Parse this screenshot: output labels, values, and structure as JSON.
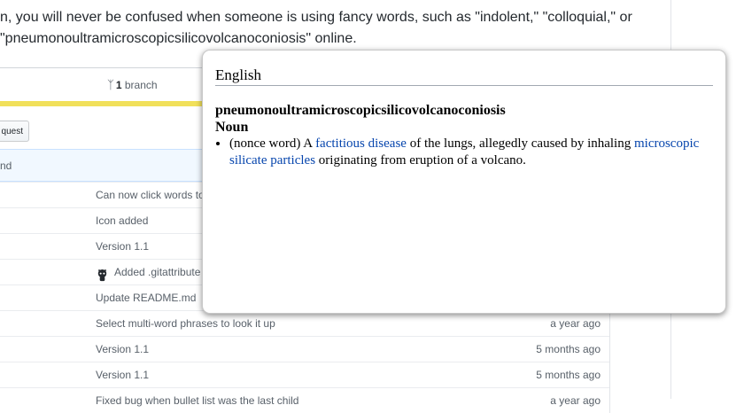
{
  "intro": {
    "line1": "n, you will never be confused when someone is using fancy words, such as \"indolent,\" \"colloquial,\" or",
    "line2": "\"pneumonoultramicroscopicsilicovolcanoconiosis\" online."
  },
  "repo": {
    "branch_count": "1",
    "branch_label": "branch",
    "pull_request_label": "quest",
    "commit_tease_text": "nd"
  },
  "files": [
    {
      "message": "Can now click words to",
      "age": ""
    },
    {
      "message": "Icon added",
      "age": ""
    },
    {
      "message": "Version 1.1",
      "age": ""
    },
    {
      "message": "Added .gitattribute",
      "age": "",
      "avatar": "octocat-icon"
    },
    {
      "message": "Update README.md",
      "age": ""
    },
    {
      "message": "Select multi-word phrases to look it up",
      "age": "a year ago"
    },
    {
      "message": "Version 1.1",
      "age": "5 months ago"
    },
    {
      "message": "Version 1.1",
      "age": "5 months ago"
    },
    {
      "message": "Fixed bug when bullet list was the last child",
      "age": "a year ago"
    }
  ],
  "popup": {
    "language": "English",
    "headword": "pneumonoultramicroscopicsilicovolcanoconiosis",
    "part_of_speech": "Noun",
    "definition": {
      "prefix": "(nonce word) A ",
      "link1": "factitious disease",
      "middle": " of the lungs, allegedly caused by inhaling ",
      "link2": "microscopic silicate particles",
      "suffix": " originating from eruption of a volcano."
    }
  },
  "colors": {
    "language_bar": "#f1e05a",
    "link": "#0645ad",
    "commit_tease_bg": "#f1f8ff"
  }
}
